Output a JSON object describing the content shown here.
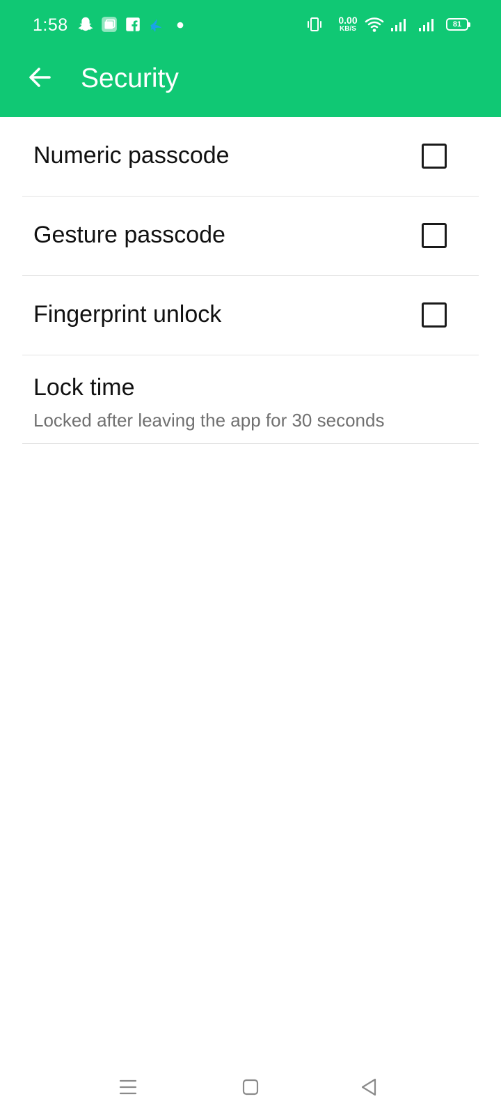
{
  "status_bar": {
    "time": "1:58",
    "net_speed_value": "0.00",
    "net_speed_unit": "KB/S",
    "battery_level": "81",
    "notification_icons": [
      "snapchat-icon",
      "stacked-app-icon",
      "facebook-icon",
      "telenor-icon",
      "dot-icon"
    ],
    "system_icons": [
      "vibrate-icon",
      "wifi-icon",
      "signal-icon",
      "signal-icon",
      "battery-icon"
    ]
  },
  "app_bar": {
    "title": "Security",
    "back_icon": "arrow-left-icon",
    "color": "#10c874"
  },
  "settings": {
    "items": [
      {
        "label": "Numeric passcode",
        "checked": false
      },
      {
        "label": "Gesture passcode",
        "checked": false
      },
      {
        "label": "Fingerprint unlock",
        "checked": false
      },
      {
        "label": "Lock time",
        "subtitle": "Locked after leaving the app for 30 seconds"
      }
    ]
  },
  "nav_bar": {
    "icons": [
      "menu-icon",
      "home-icon",
      "back-triangle-icon"
    ]
  }
}
